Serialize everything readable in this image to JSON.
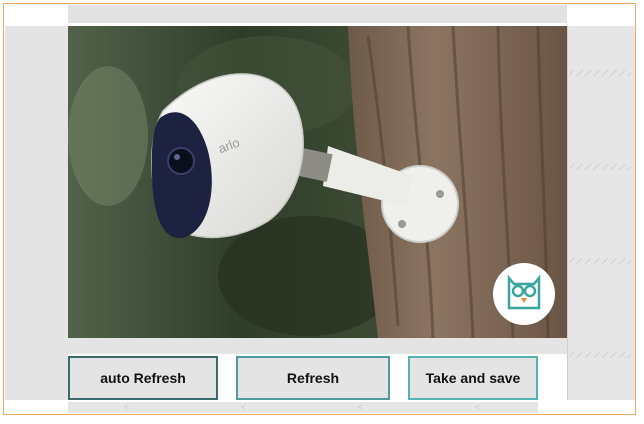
{
  "camera": {
    "brand_text": "arlo",
    "image_label": "camera-snapshot"
  },
  "buttons": {
    "auto_refresh": "auto Refresh",
    "refresh": "Refresh",
    "take_and_save": "Take and save"
  },
  "colors": {
    "window_border": "#f0a860",
    "button_border": "#4a8a8c",
    "panel_gray": "#e4e4e4"
  }
}
